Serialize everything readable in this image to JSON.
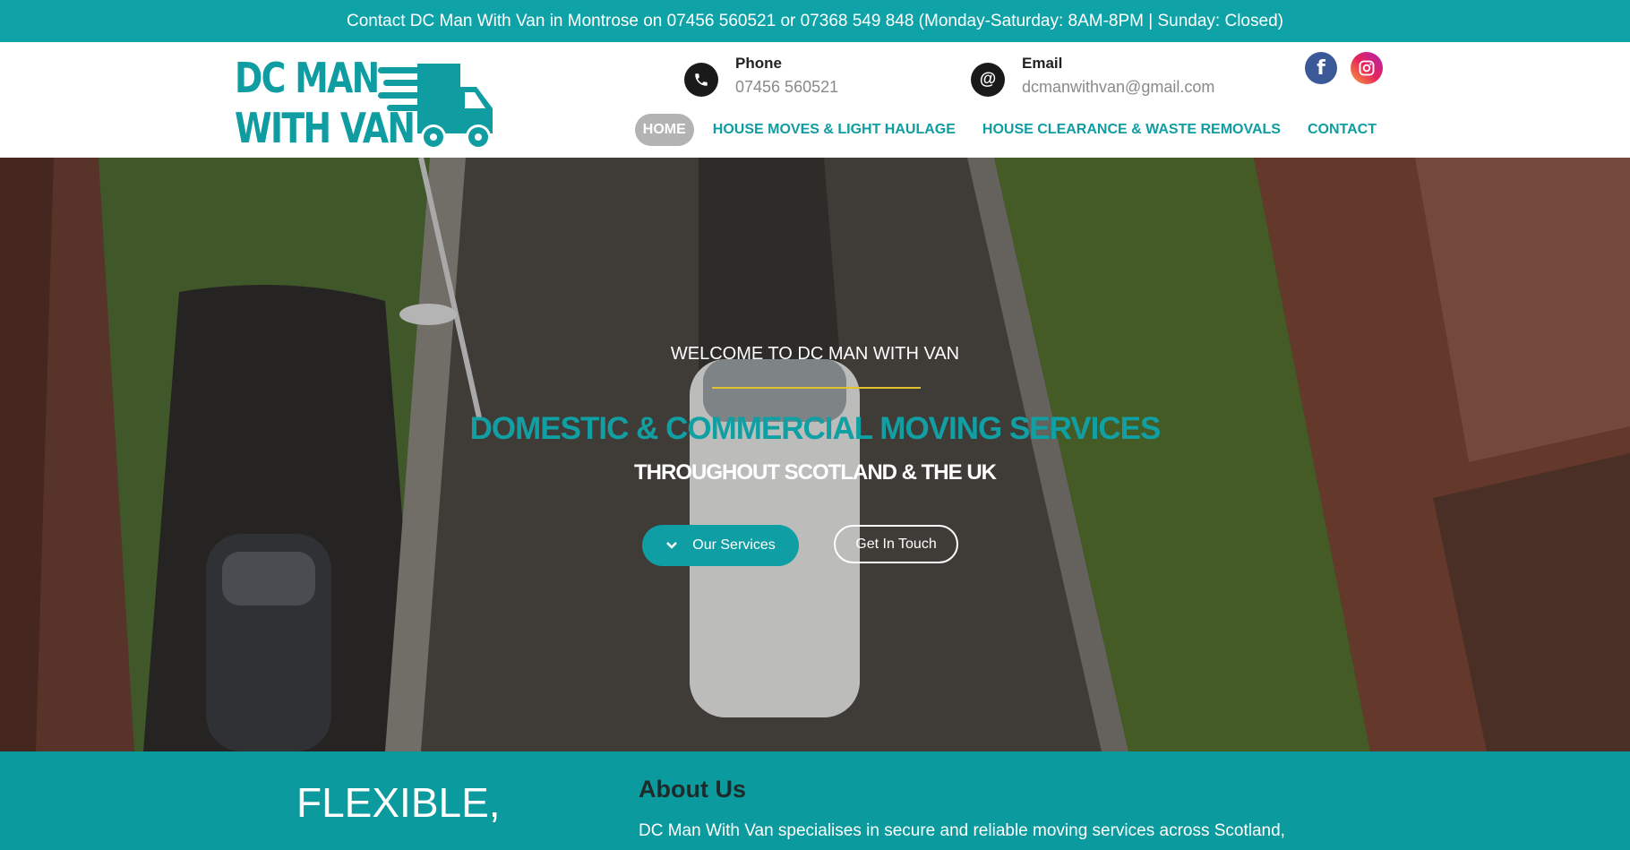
{
  "topbar": {
    "text": "Contact DC Man With Van in Montrose on 07456 560521 or 07368 549 848 (Monday-Saturday: 8AM-8PM | Sunday: Closed)"
  },
  "logo": {
    "line1": "DC MAN",
    "line2": "WITH VAN",
    "icon": "van-icon"
  },
  "contacts": {
    "phone": {
      "label": "Phone",
      "value": "07456 560521",
      "icon": "phone-icon"
    },
    "email": {
      "label": "Email",
      "value": "dcmanwithvan@gmail.com",
      "icon": "at-icon"
    }
  },
  "social": {
    "facebook": {
      "glyph": "f",
      "icon": "facebook-icon"
    },
    "instagram": {
      "icon": "instagram-icon"
    }
  },
  "nav": [
    {
      "label": "HOME",
      "active": true
    },
    {
      "label": "HOUSE MOVES & LIGHT HAULAGE",
      "active": false
    },
    {
      "label": "HOUSE CLEARANCE & WASTE REMOVALS",
      "active": false
    },
    {
      "label": "CONTACT",
      "active": false
    }
  ],
  "hero": {
    "welcome": "WELCOME TO DC MAN WITH VAN",
    "title": "DOMESTIC & COMMERCIAL MOVING SERVICES",
    "subtitle": "THROUGHOUT SCOTLAND & THE UK",
    "btn_services": "Our Services",
    "btn_touch": "Get In Touch"
  },
  "about": {
    "tagline": "FLEXIBLE,",
    "heading": "About Us",
    "text": "DC Man With Van specialises in secure and reliable moving services across Scotland,"
  },
  "colors": {
    "brand_teal": "#0fa3a8",
    "accent_yellow": "#e3c12a",
    "facebook_blue": "#3b5998"
  }
}
